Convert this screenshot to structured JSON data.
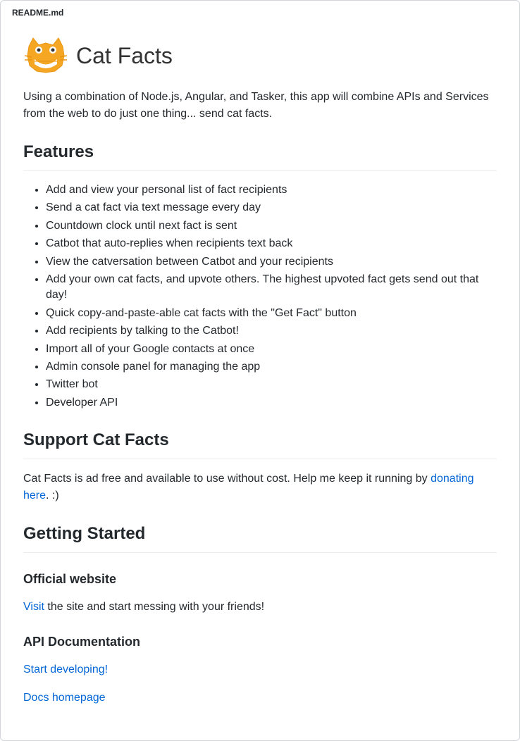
{
  "filename": "README.md",
  "logo_text": "Cat Facts",
  "description": "Using a combination of Node.js, Angular, and Tasker, this app will combine APIs and Services from the web to do just one thing... send cat facts.",
  "features": {
    "heading": "Features",
    "items": [
      "Add and view your personal list of fact recipients",
      "Send a cat fact via text message every day",
      "Countdown clock until next fact is sent",
      "Catbot that auto-replies when recipients text back",
      "View the catversation between Catbot and your recipients",
      "Add your own cat facts, and upvote others. The highest upvoted fact gets send out that day!",
      "Quick copy-and-paste-able cat facts with the \"Get Fact\" button",
      "Add recipients by talking to the Catbot!",
      "Import all of your Google contacts at once",
      "Admin console panel for managing the app",
      "Twitter bot",
      "Developer API"
    ]
  },
  "support": {
    "heading": "Support Cat Facts",
    "text_before": "Cat Facts is ad free and available to use without cost. Help me keep it running by ",
    "link_text": "donating here",
    "text_after": ". :)"
  },
  "getting_started": {
    "heading": "Getting Started"
  },
  "official_website": {
    "heading": "Official website",
    "link_text": "Visit",
    "text_after": " the site and start messing with your friends!"
  },
  "api_docs": {
    "heading": "API Documentation",
    "link1": "Start developing!",
    "link2": "Docs homepage"
  }
}
